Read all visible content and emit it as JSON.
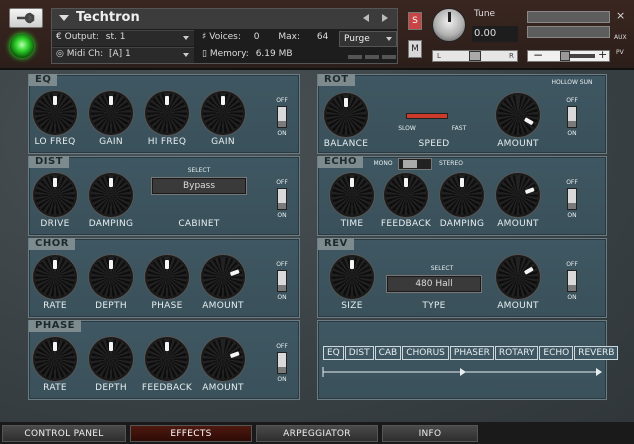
{
  "header": {
    "instrument_name": "Techtron",
    "output_label": "Output:",
    "output_value": "st. 1",
    "voices_label": "Voices:",
    "voices_value": "0",
    "max_label": "Max:",
    "max_value": "64",
    "midi_label": "Midi Ch:",
    "midi_value": "[A]  1",
    "memory_label": "Memory:",
    "memory_value": "6.19 MB",
    "purge_label": "Purge",
    "solo_label": "S",
    "mute_label": "M",
    "tune_label": "Tune",
    "tune_value": "0.00",
    "pan_left": "L",
    "pan_right": "R",
    "vol_minus": "−",
    "vol_plus": "+",
    "close_label": "×",
    "aux_label": "AUX",
    "pv_label": "PV"
  },
  "panels": {
    "eq": {
      "title": "EQ",
      "knobs": [
        "LO FREQ",
        "GAIN",
        "HI FREQ",
        "GAIN"
      ],
      "switch_off": "OFF",
      "switch_on": "ON"
    },
    "rot": {
      "title": "ROT",
      "preset_label": "HOLLOW SUN",
      "knob_balance": "BALANCE",
      "speed_label": "SPEED",
      "slow_label": "SLOW",
      "fast_label": "FAST",
      "knob_amount": "AMOUNT",
      "switch_off": "OFF",
      "switch_on": "ON"
    },
    "dist": {
      "title": "DIST",
      "knobs": [
        "DRIVE",
        "DAMPING"
      ],
      "select_label": "SELECT",
      "select_value": "Bypass",
      "cabinet_label": "CABINET",
      "switch_off": "OFF",
      "switch_on": "ON"
    },
    "echo": {
      "title": "ECHO",
      "mono_label": "MONO",
      "stereo_label": "STEREO",
      "knobs": [
        "TIME",
        "FEEDBACK",
        "DAMPING",
        "AMOUNT"
      ],
      "switch_off": "OFF",
      "switch_on": "ON"
    },
    "chor": {
      "title": "CHOR",
      "knobs": [
        "RATE",
        "DEPTH",
        "PHASE",
        "AMOUNT"
      ],
      "switch_off": "OFF",
      "switch_on": "ON"
    },
    "rev": {
      "title": "REV",
      "knob_size": "SIZE",
      "select_label": "SELECT",
      "select_value": "480 Hall",
      "type_label": "TYPE",
      "knob_amount": "AMOUNT",
      "switch_off": "OFF",
      "switch_on": "ON"
    },
    "phase": {
      "title": "PHASE",
      "knobs": [
        "RATE",
        "DEPTH",
        "FEEDBACK",
        "AMOUNT"
      ],
      "switch_off": "OFF",
      "switch_on": "ON"
    },
    "chain": {
      "items": [
        "EQ",
        "DIST",
        "CAB",
        "CHORUS",
        "PHASER",
        "ROTARY",
        "ECHO",
        "REVERB"
      ]
    }
  },
  "footer": {
    "tabs": [
      "CONTROL PANEL",
      "EFFECTS",
      "ARPEGGIATOR",
      "INFO"
    ],
    "active_tab": "EFFECTS"
  },
  "colors": {
    "panel_bg": "#3f5762",
    "panel_tab": "#7d8b8f",
    "active_tab": "#4e1a10",
    "power_led": "#2ed12a"
  }
}
